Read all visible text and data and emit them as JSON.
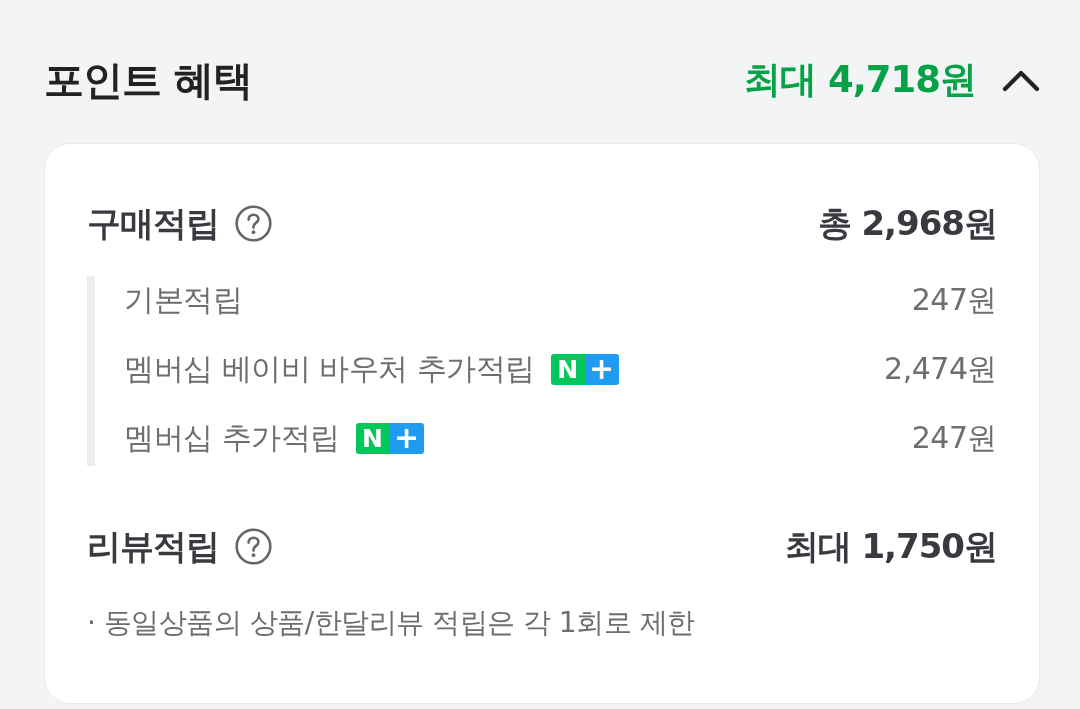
{
  "header": {
    "title": "포인트 혜택",
    "total": "최대 4,718원",
    "expanded": true
  },
  "sections": [
    {
      "title": "구매적립",
      "amount": "총 2,968원",
      "items": [
        {
          "label": "기본적립",
          "value": "247원"
        },
        {
          "label": "멤버십 베이비 바우처 추가적립",
          "value": "2,474원",
          "membership_mark": {
            "letter": "N",
            "symbol": "+"
          }
        },
        {
          "label": "멤버십 추가적립",
          "value": "247원",
          "membership_mark": {
            "letter": "N",
            "symbol": "+"
          }
        }
      ]
    },
    {
      "title": "리뷰적립",
      "amount": "최대 1,750원",
      "notes": [
        "· 동일상품의 상품/한달리뷰 적립은 각 1회로 제한"
      ]
    }
  ]
}
